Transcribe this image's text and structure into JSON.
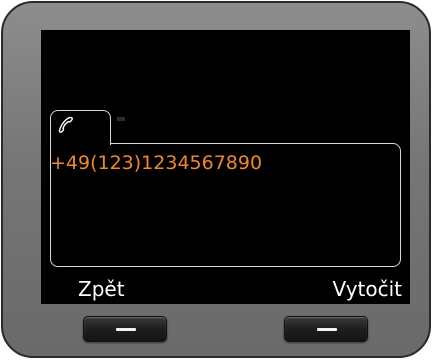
{
  "call_screen": {
    "tab_icon": "phone-handset-icon",
    "dialed_number": "+49(123)1234567890"
  },
  "softkeys": {
    "left_label": "Zpět",
    "right_label": "Vytočit"
  },
  "colors": {
    "number_text": "#f0882a",
    "screen_background": "#000000",
    "device_body": "#7a7a7a"
  }
}
